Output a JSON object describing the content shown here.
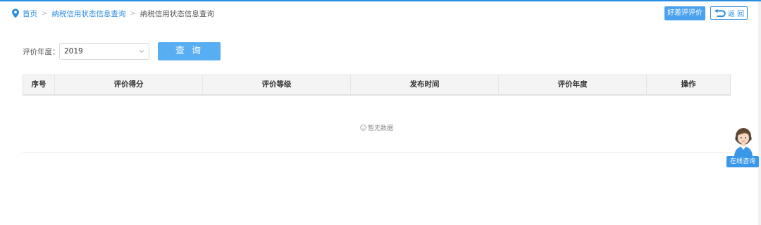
{
  "breadcrumb": {
    "home": "首页",
    "parent": "纳税信用状态信息查询",
    "current": "纳税信用状态信息查询"
  },
  "toolbar": {
    "rate_label": "好差评评价",
    "back_label": "返 回"
  },
  "filter": {
    "year_label": "评价年度：",
    "year_value": "2019",
    "query_label": "查 询"
  },
  "table": {
    "columns": [
      "序号",
      "评价得分",
      "评价等级",
      "发布时间",
      "评价年度",
      "操作"
    ],
    "rows": [],
    "empty_text": "暂无数据"
  },
  "consult": {
    "label": "在线咨询"
  },
  "colors": {
    "accent": "#2b8de0",
    "button": "#58aef2"
  }
}
